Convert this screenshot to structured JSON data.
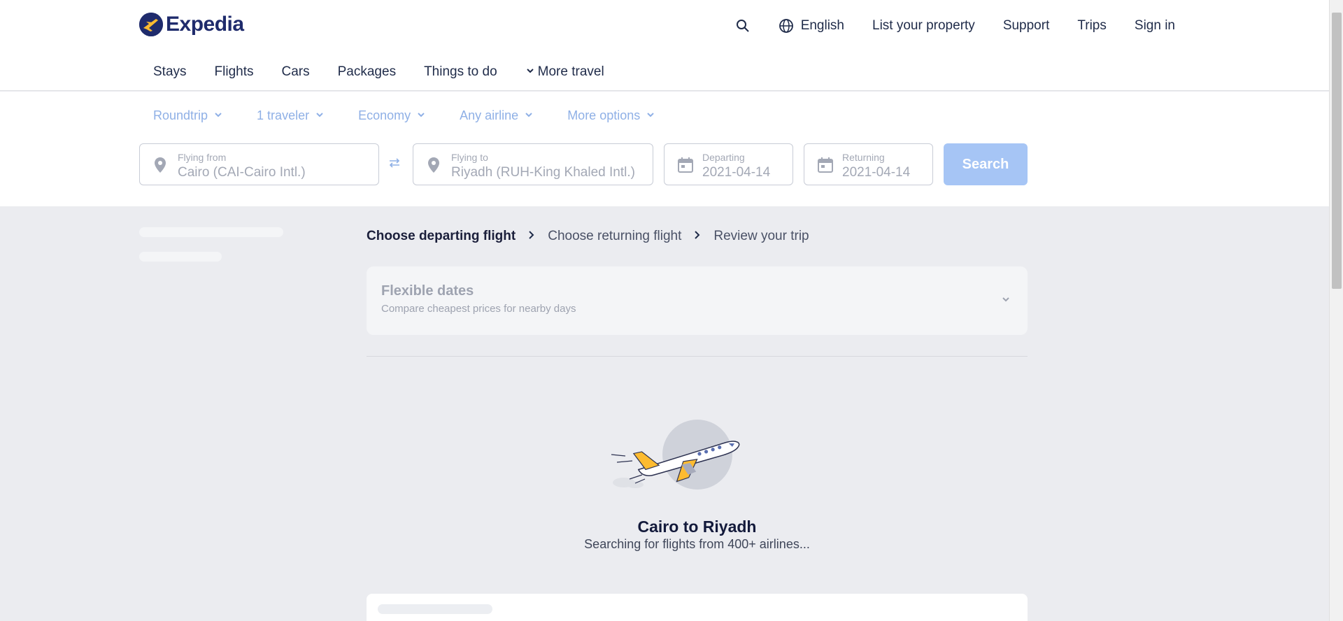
{
  "brand": {
    "name": "Expedia",
    "color": "#1f2b6c",
    "accent": "#fdbb30"
  },
  "header": {
    "language": "English",
    "list_property": "List your property",
    "support": "Support",
    "trips": "Trips",
    "sign_in": "Sign in"
  },
  "categories": {
    "stays": "Stays",
    "flights": "Flights",
    "cars": "Cars",
    "packages": "Packages",
    "things_to_do": "Things to do",
    "more_travel": "More travel"
  },
  "search": {
    "trip_type": "Roundtrip",
    "travelers": "1 traveler",
    "cabin": "Economy",
    "airline": "Any airline",
    "more_options": "More options",
    "from_label": "Flying from",
    "from_value": "Cairo (CAI-Cairo Intl.)",
    "to_label": "Flying to",
    "to_value": "Riyadh (RUH-King Khaled Intl.)",
    "depart_label": "Departing",
    "depart_value": "2021-04-14",
    "return_label": "Returning",
    "return_value": "2021-04-14",
    "button": "Search"
  },
  "steps": {
    "step1": "Choose departing flight",
    "step2": "Choose returning flight",
    "step3": "Review your trip"
  },
  "flexible": {
    "title": "Flexible dates",
    "subtitle": "Compare cheapest prices for nearby days"
  },
  "results": {
    "title": "Cairo to Riyadh",
    "subtitle": "Searching for flights from 400+ airlines..."
  },
  "icons": [
    "search-icon",
    "globe-icon",
    "chevron-down-icon",
    "location-pin-icon",
    "swap-icon",
    "calendar-icon",
    "chevron-right-icon",
    "airplane-illustration"
  ]
}
